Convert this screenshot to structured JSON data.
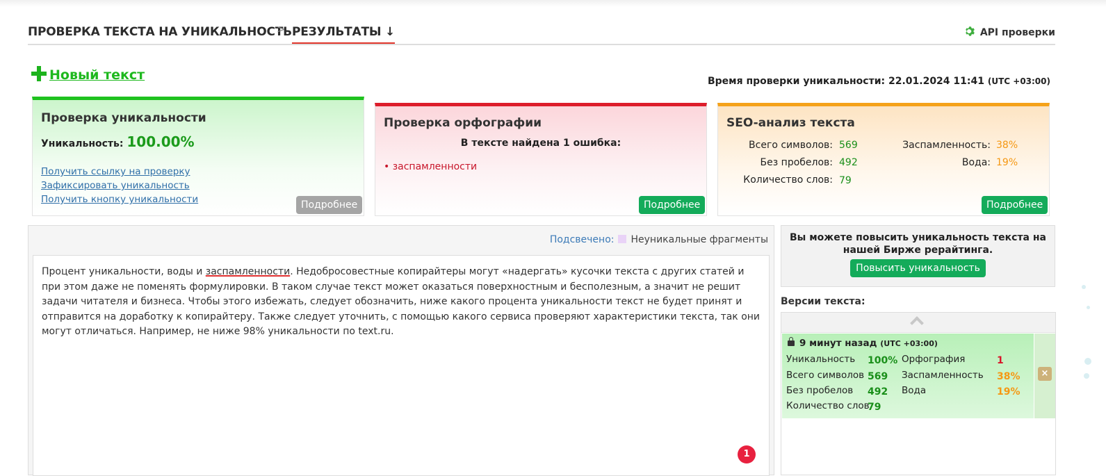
{
  "nav": {
    "crumb1": "ПРОВЕРКА ТЕКСТА НА УНИКАЛЬНОСТЬ",
    "separator": ">",
    "crumb2": "РЕЗУЛЬТАТЫ ↓",
    "api": "API проверки"
  },
  "new_text": "Новый текст",
  "check_time": {
    "label": "Время проверки уникальности: 22.01.2024 11:41",
    "tz": "(UTC +03:00)"
  },
  "uniqueness_card": {
    "title": "Проверка уникальности",
    "label": "Уникальность:",
    "value": "100.00%",
    "links": [
      "Получить ссылку на проверку",
      "Зафиксировать уникальность",
      "Получить кнопку уникальности"
    ],
    "more": "Подробнее"
  },
  "spelling_card": {
    "title": "Проверка орфографии",
    "found": "В тексте найдена 1 ошибка:",
    "error": "• заспамленности",
    "more": "Подробнее"
  },
  "seo_card": {
    "title": "SEO-анализ текста",
    "total_label": "Всего символов:",
    "total": "569",
    "nospace_label": "Без пробелов:",
    "nospace": "492",
    "words_label": "Количество слов:",
    "words": "79",
    "spam_label": "Заспамленность:",
    "spam": "38%",
    "water_label": "Вода:",
    "water": "19%",
    "more": "Подробнее"
  },
  "highlight": {
    "label": "Подсвечено:",
    "legend": "Неуникальные фрагменты"
  },
  "text": {
    "part1": "Процент уникальности, воды и ",
    "misspelled": "заспамленности",
    "part2": ". Недобросовестные копирайтеры могут «надергать» кусочки текста с других статей и при этом даже не поменять формулировки. В таком случае текст может оказаться поверхностным и бесполезным, а значит не решит задачи читателя и бизнеса. Чтобы этого избежать, следует обозначить, ниже какого процента уникальности текст не будет принят и отправится на доработку к копирайтеру. Также следует уточнить, с помощью какого сервиса проверяют характеристики текста, так они могут отличаться. Например, не ниже 98% уникальности по text.ru."
  },
  "error_badge": "1",
  "promo": {
    "text": "Вы можете повысить уникальность текста на нашей Бирже рерайтинга.",
    "button": "Повысить уникальность"
  },
  "versions": {
    "title": "Версии текста:",
    "entry": {
      "ago": "9 минут назад",
      "tz": "(UTC +03:00)",
      "uniq_label": "Уникальность",
      "uniq": "100%",
      "total_label": "Всего символов",
      "total": "569",
      "nospace_label": "Без пробелов",
      "nospace": "492",
      "words_label": "Количество слов",
      "words": "79",
      "spell_label": "Орфография",
      "spell": "1",
      "spam_label": "Заспамленность",
      "spam": "38%",
      "water_label": "Вода",
      "water": "19%",
      "delete": "×"
    }
  },
  "colors": {
    "green": "#1eb81e",
    "red": "#dd1d2b",
    "orange": "#f5a21a",
    "button": "#14ab5a"
  }
}
